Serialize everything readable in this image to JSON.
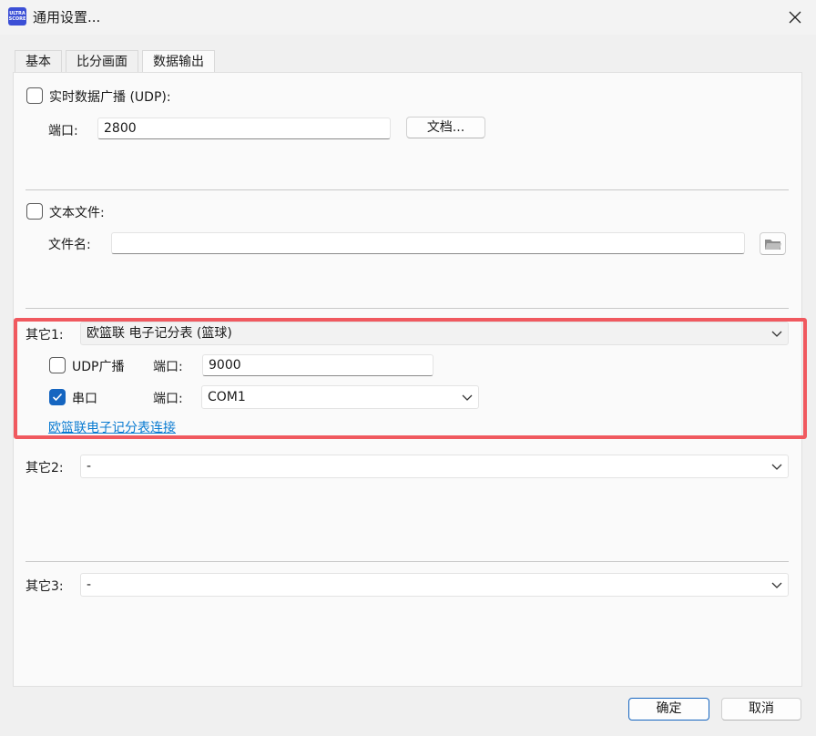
{
  "window": {
    "title": "通用设置...",
    "app_icon_text": "ULTRA SCORE"
  },
  "tabs": [
    {
      "label": "基本",
      "active": false
    },
    {
      "label": "比分画面",
      "active": false
    },
    {
      "label": "数据输出",
      "active": true
    }
  ],
  "udp_section": {
    "checkbox_label": "实时数据广播 (UDP):",
    "checked": false,
    "port_label": "端口:",
    "port_value": "2800",
    "docs_button": "文档..."
  },
  "text_file_section": {
    "checkbox_label": "文本文件:",
    "checked": false,
    "filename_label": "文件名:",
    "filename_value": ""
  },
  "other1": {
    "label": "其它1:",
    "selected": "欧篮联 电子记分表 (篮球)",
    "udp_checkbox_label": "UDP广播",
    "udp_checked": false,
    "udp_port_label": "端口:",
    "udp_port_value": "9000",
    "serial_checkbox_label": "串口",
    "serial_checked": true,
    "serial_port_label": "端口:",
    "serial_port_value": "COM1",
    "link_text": "欧篮联电子记分表连接"
  },
  "other2": {
    "label": "其它2:",
    "selected": "-"
  },
  "other3": {
    "label": "其它3:",
    "selected": "-"
  },
  "footer": {
    "ok": "确定",
    "cancel": "取消"
  },
  "colors": {
    "accent": "#1565c0",
    "highlight_border": "#f0595f",
    "link": "#0a7bd1"
  }
}
